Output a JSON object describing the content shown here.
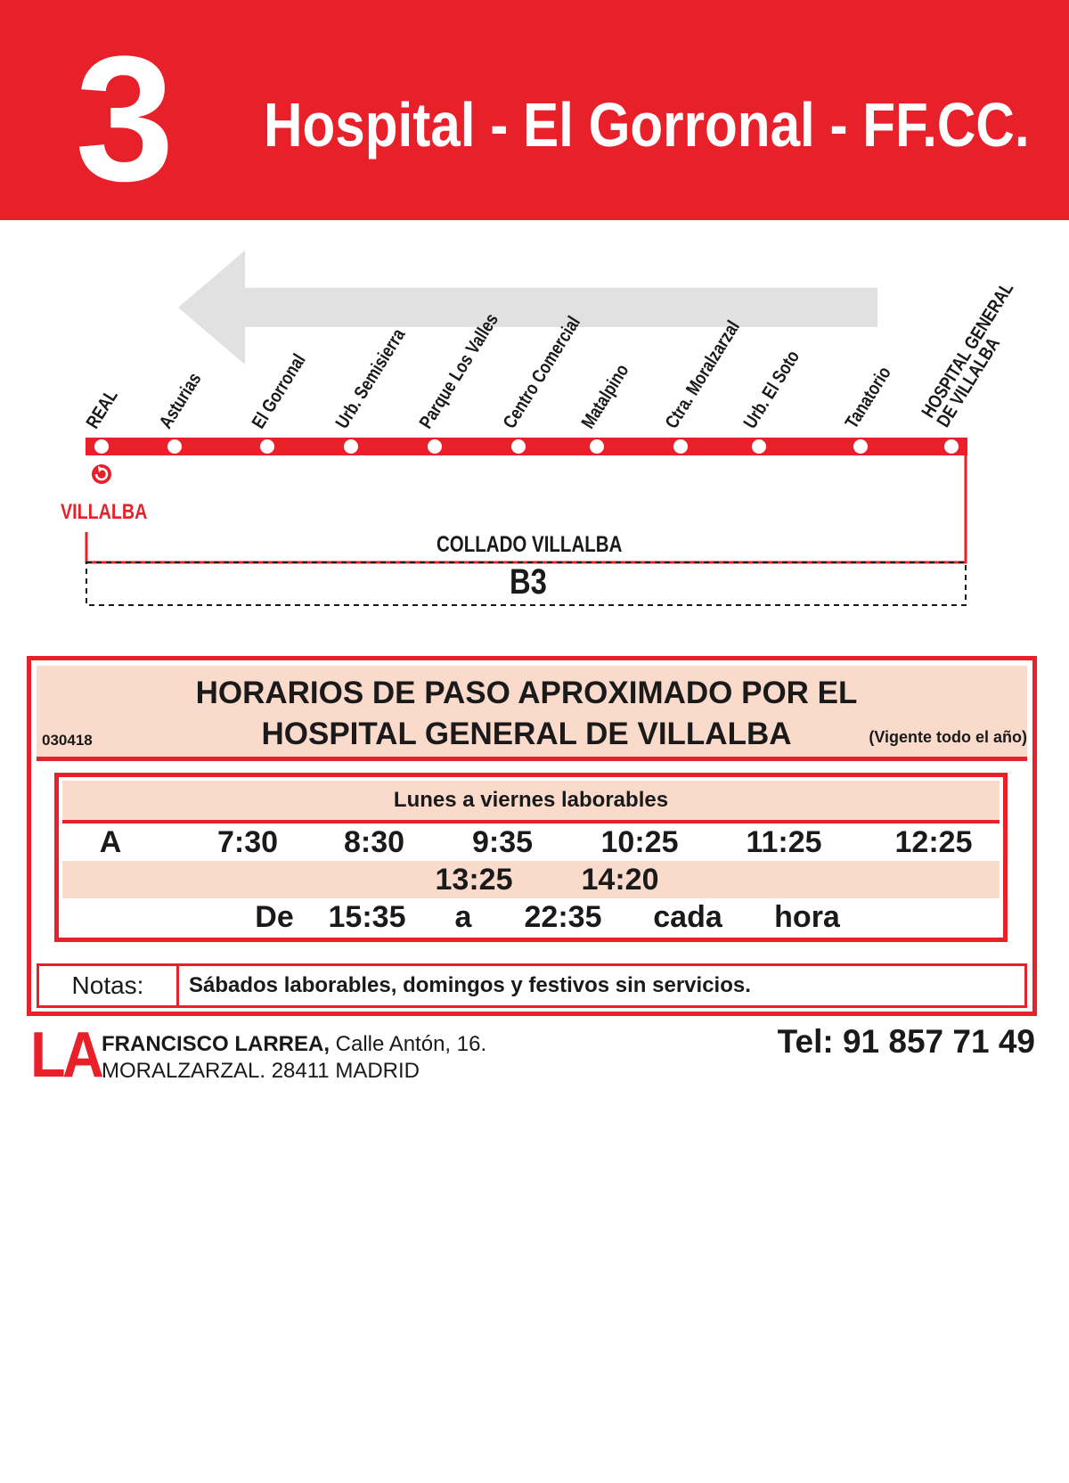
{
  "header": {
    "line_number": "3",
    "route_title": "Hospital - El Gorronal - FF.CC."
  },
  "diagram": {
    "stops": [
      {
        "label": "REAL"
      },
      {
        "label": "Asturias"
      },
      {
        "label": "El Gorronal"
      },
      {
        "label": "Urb. Semisierra"
      },
      {
        "label": "Parque Los Valles"
      },
      {
        "label": "Centro Comercial"
      },
      {
        "label": "Matalpino"
      },
      {
        "label": "Ctra. Moralzarzal"
      },
      {
        "label": "Urb. El Soto"
      },
      {
        "label": "Tanatorio"
      },
      {
        "label": "HOSPITAL GENERAL\nDE VILLALBA"
      }
    ],
    "terminal_town": "VILLALBA",
    "municipality": "COLLADO VILLALBA",
    "zone": "B3",
    "colors": {
      "line": "#e8202a",
      "arrow": "#e1e1e1"
    }
  },
  "timetable": {
    "title_line1": "HORARIOS DE PASO APROXIMADO POR EL",
    "title_line2": "HOSPITAL GENERAL DE VILLALBA",
    "code": "030418",
    "validity": "(Vigente todo el año)",
    "schedule_header": "Lunes a viernes laborables",
    "rows": [
      [
        "A",
        "7:30",
        "8:30",
        "9:35",
        "10:25",
        "11:25",
        "12:25"
      ],
      [
        "13:25",
        "14:20"
      ],
      [
        "De",
        "15:35",
        "a",
        "22:35",
        "cada",
        "hora"
      ]
    ],
    "notes_label": "Notas:",
    "notes_text": "Sábados laborables, domingos y festivos sin servicios."
  },
  "footer": {
    "logo": "LA",
    "company_name": "FRANCISCO LARREA,",
    "company_address": " Calle Antón, 16.",
    "company_line2": "MORALZARZAL. 28411 MADRID",
    "phone": "Tel: 91 857 71 49"
  },
  "colors": {
    "brand_red": "#e8202a",
    "salmon": "#fadacb"
  }
}
